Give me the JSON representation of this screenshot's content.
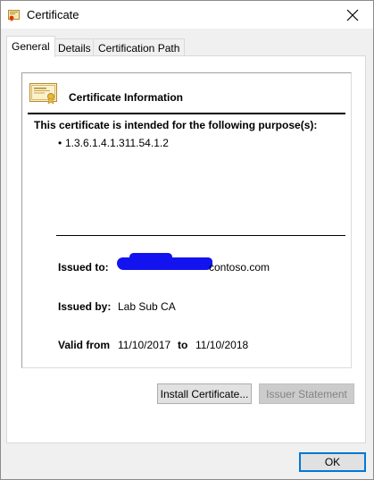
{
  "window": {
    "title": "Certificate",
    "icon": "certificate-icon",
    "close_icon": "close-icon"
  },
  "tabs": [
    {
      "label": "General",
      "selected": true
    },
    {
      "label": "Details",
      "selected": false
    },
    {
      "label": "Certification Path",
      "selected": false
    }
  ],
  "certificate_info": {
    "icon": "certificate-icon",
    "heading": "Certificate Information",
    "purpose_heading": "This certificate is intended for the following purpose(s):",
    "purposes": [
      "1.3.6.1.4.1.311.54.1.2"
    ],
    "issued_to_label": "Issued to:",
    "issued_to_value": "contoso.com",
    "issued_by_label": "Issued by:",
    "issued_by_value": "Lab Sub CA",
    "valid_from_label": "Valid from",
    "valid_from_value": "11/10/2017",
    "valid_to_label": "to",
    "valid_to_value": "11/10/2018"
  },
  "actions": {
    "install_label": "Install Certificate...",
    "issuer_label": "Issuer Statement",
    "issuer_enabled": false,
    "ok_label": "OK"
  },
  "colors": {
    "redaction": "#1313f0",
    "ok_border": "#0078d7"
  }
}
